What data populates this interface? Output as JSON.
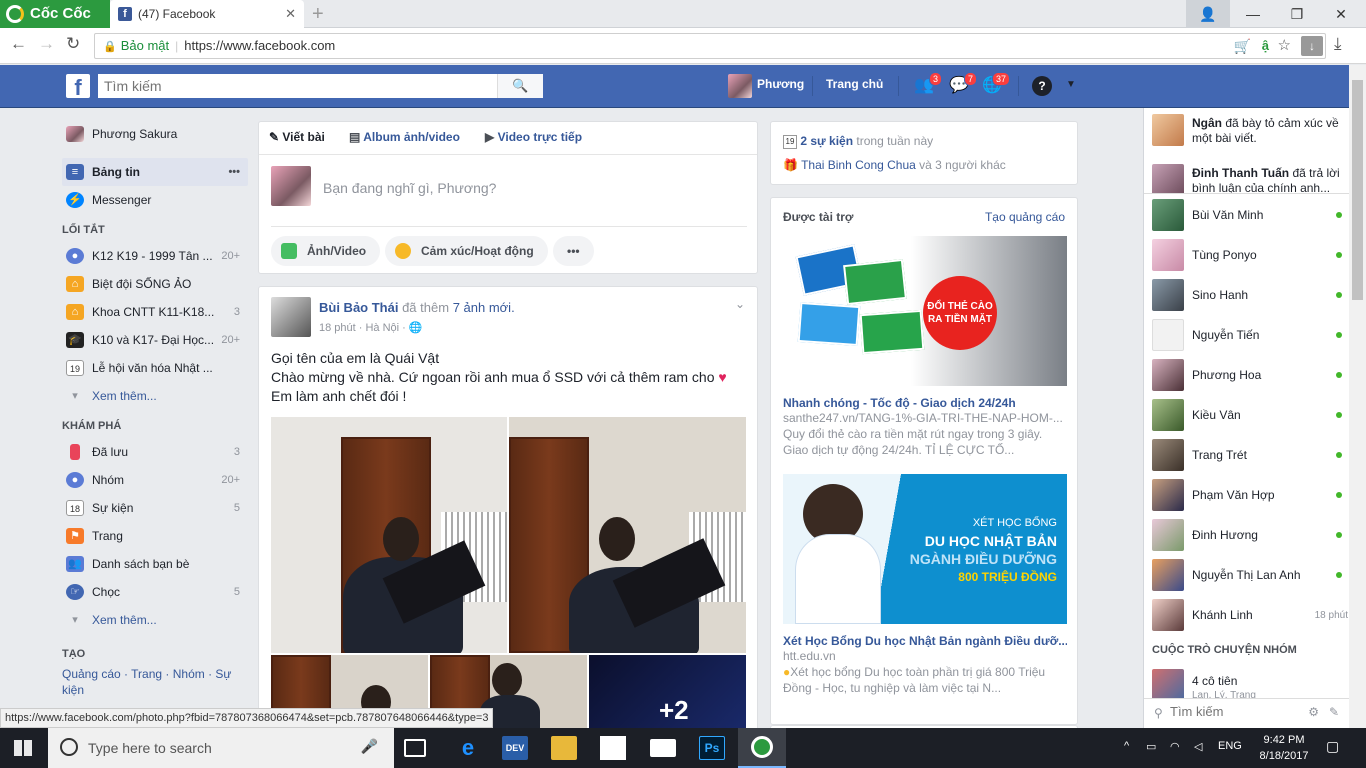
{
  "browser": {
    "brand": "Cốc Cốc",
    "tab_title": "(47) Facebook",
    "secure_label": "Bảo mật",
    "url": "https://www.facebook.com",
    "status_url": "https://www.facebook.com/photo.php?fbid=787807368066474&set=pcb.787807648066446&type=3"
  },
  "fb_header": {
    "search_placeholder": "Tìm kiếm",
    "profile_name": "Phương",
    "home_label": "Trang chủ",
    "friend_requests": "3",
    "messages": "7",
    "notifications": "37",
    "brand_color": "#4267b2"
  },
  "left_nav": {
    "profile": "Phương Sakura",
    "news_feed": "Bảng tin",
    "messenger": "Messenger",
    "shortcuts_heading": "LỐI TẮT",
    "shortcuts": [
      {
        "label": "K12 K19 - 1999 Tân ...",
        "count": "20+"
      },
      {
        "label": "Biệt đội SỐNG ẢO",
        "count": ""
      },
      {
        "label": "Khoa CNTT K11-K18...",
        "count": "3"
      },
      {
        "label": "K10 và K17- Đại Học...",
        "count": "20+"
      },
      {
        "label": "Lễ hội văn hóa Nhật ...",
        "count": ""
      }
    ],
    "see_more": "Xem thêm...",
    "explore_heading": "KHÁM PHÁ",
    "explore": [
      {
        "label": "Đã lưu",
        "count": "3"
      },
      {
        "label": "Nhóm",
        "count": "20+"
      },
      {
        "label": "Sự kiện",
        "count": "5"
      },
      {
        "label": "Trang",
        "count": ""
      },
      {
        "label": "Danh sách bạn bè",
        "count": ""
      },
      {
        "label": "Chọc",
        "count": "5"
      }
    ],
    "see_more2": "Xem thêm...",
    "create_heading": "TẠO",
    "create_links": "Quảng cáo · Trang · Nhóm · Sự kiện"
  },
  "composer": {
    "tab_post": "Viết bài",
    "tab_album": "Album ảnh/video",
    "tab_live": "Video trực tiếp",
    "prompt": "Bạn đang nghĩ gì, Phương?",
    "photo_btn": "Ảnh/Video",
    "feeling_btn": "Cảm xúc/Hoạt động",
    "more_btn": "•••"
  },
  "post": {
    "author": "Bùi Bảo Thái",
    "action": "đã thêm",
    "action_link": "7 ảnh mới.",
    "meta": "18 phút · Hà Nội · ",
    "line1": "Gọi tên của em là Quái Vật",
    "line2": "Chào mừng về nhà. Cứ ngoan rồi anh mua ổ SSD với cả thêm ram cho ",
    "line3": "Em làm anh chết đói !"
  },
  "right_col": {
    "events_count": "2 sự kiện",
    "events_suffix": " trong tuần này",
    "birthday_name": "Thai Binh Cong Chua",
    "birthday_suffix": " và 3 người khác",
    "sponsored": "Được tài trợ",
    "create_ad": "Tạo quảng cáo",
    "ad1_banner_top": "ĐỔI THẺ CÀO",
    "ad1_banner_bottom": "RA TIỀN MẶT",
    "ad1_title": "Nhanh chóng - Tốc độ - Giao dịch 24/24h",
    "ad1_url": "santhe247.vn/TANG-1%-GIA-TRI-THE-NAP-HOM-...",
    "ad1_desc": "Quy đổi thẻ cào ra tiền mặt rút ngay trong 3 giây. Giao dịch tự động 24/24h. TỈ LỆ CỰC TỐ...",
    "ad2_banner_1": "XÉT HỌC BỔNG",
    "ad2_banner_2": "DU HỌC NHẬT BẢN",
    "ad2_banner_3": "NGÀNH ĐIỀU DƯỠNG",
    "ad2_banner_4": "800 TRIỆU ĐỒNG",
    "ad2_title": "Xét Học Bổng Du học Nhật Bản ngành Điều dưỡ...",
    "ad2_url": "htt.edu.vn",
    "ad2_desc": "Xét học bổng Du học toàn phần trị giá 800 Triệu Đồng - Học, tu nghiệp và làm việc tại N..."
  },
  "chat": {
    "ticker1_name": "Ngân",
    "ticker1_text": " đã bày tỏ cảm xúc về một bài viết.",
    "ticker2_name": "Đinh Thanh Tuấn",
    "ticker2_text": " đã trả lời bình luận của chính anh...",
    "contacts": [
      {
        "name": "Bùi Văn Minh",
        "status": "online"
      },
      {
        "name": "Tùng Ponyo",
        "status": "online"
      },
      {
        "name": "Sino Hanh",
        "status": "online"
      },
      {
        "name": "Nguyễn Tiến",
        "status": "online"
      },
      {
        "name": "Phương Hoa",
        "status": "online"
      },
      {
        "name": "Kiều Vân",
        "status": "online"
      },
      {
        "name": "Trang Trét",
        "status": "online"
      },
      {
        "name": "Phạm Văn Hợp",
        "status": "online"
      },
      {
        "name": "Đinh Hương",
        "status": "online"
      },
      {
        "name": "Nguyễn Thị Lan Anh",
        "status": "online"
      },
      {
        "name": "Khánh Linh",
        "status": "18 phút"
      }
    ],
    "group_heading": "CUỘC TRÒ CHUYỆN NHÓM",
    "group_name": "4 cô tiên",
    "group_members": "Lan, Lý, Trang",
    "search_placeholder": "Tìm kiếm"
  },
  "taskbar": {
    "search_placeholder": "Type here to search",
    "lang": "ENG",
    "time": "9:42 PM",
    "date": "8/18/2017",
    "dev_label": "DEV",
    "ps_label": "Ps"
  }
}
